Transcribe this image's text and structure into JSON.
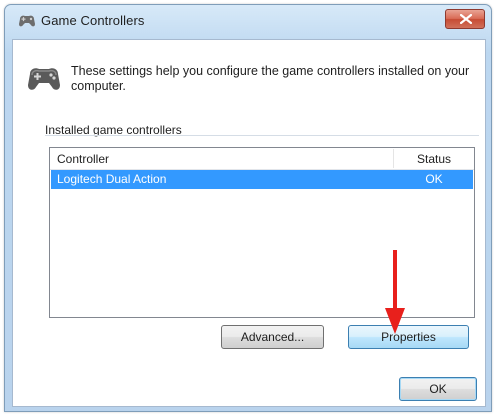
{
  "window": {
    "title": "Game Controllers",
    "close_icon": "close-icon",
    "title_icon": "gamepad-icon"
  },
  "header": {
    "icon": "gamepad-icon",
    "description": "These settings help you configure the game controllers installed on your computer."
  },
  "group": {
    "label": "Installed game controllers"
  },
  "list": {
    "columns": [
      "Controller",
      "Status"
    ],
    "rows": [
      {
        "controller": "Logitech Dual Action",
        "status": "OK",
        "selected": true
      }
    ],
    "selection_color": "#3399ff"
  },
  "buttons": {
    "advanced": "Advanced...",
    "properties": "Properties",
    "ok": "OK"
  },
  "annotation": {
    "arrow_color": "#e8201c",
    "icon": "arrow-down-icon"
  }
}
